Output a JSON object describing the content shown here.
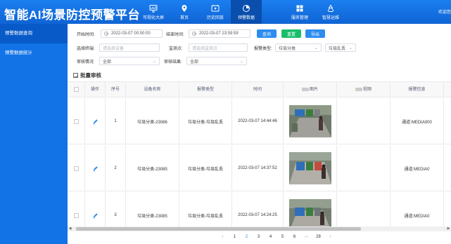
{
  "header": {
    "app_title": "智能AI场景防控预警平台",
    "welcome": "欢迎您",
    "nav": [
      {
        "label": "可视化大屏",
        "icon": "chart-monitor-icon"
      },
      {
        "label": "首页",
        "icon": "location-pin-icon"
      },
      {
        "label": "历史回放",
        "icon": "history-play-icon"
      },
      {
        "label": "预警数据",
        "icon": "pie-chart-icon",
        "active": true
      },
      {
        "label": "服务管理",
        "icon": "grid-icon"
      },
      {
        "label": "智慧运维",
        "icon": "recycle-icon"
      }
    ]
  },
  "sidebar": {
    "items": [
      {
        "label": "预警数据查询",
        "active": true
      },
      {
        "label": "预警数据统计"
      }
    ]
  },
  "filters": {
    "start_label": "开始时间:",
    "start_value": "2022-03-07 00:00:00",
    "end_label": "结束时间:",
    "end_value": "2022-03-07 23:59:59",
    "query_btn": "查询",
    "reset_btn": "重置",
    "export_btn": "导出",
    "terminal_label": "选择终端:",
    "terminal_placeholder": "请选择设备",
    "monitor_label": "监测点:",
    "monitor_placeholder": "请选择监测点",
    "alarm_type_label": "报警类型:",
    "alarm_type_value": "垃圾分类",
    "alarm_subtype_value": "垃圾乱丢",
    "review_label": "审核情况",
    "review_value": "全部",
    "result_label": "审核结果:",
    "result_value": "全部"
  },
  "batch_label": "批量审核",
  "table": {
    "columns": [
      "",
      "操作",
      "序号",
      "设备名称",
      "报警类型",
      "时间",
      "图片",
      "视频",
      "报警信息"
    ],
    "rows": [
      {
        "index": "1",
        "device": "垃圾分类-23086",
        "type": "垃圾分类-垃圾乱丢",
        "time": "2022-03-07 14:44:46",
        "info": "通道:MEDIA000"
      },
      {
        "index": "2",
        "device": "垃圾分类-23085",
        "type": "垃圾分类-垃圾乱丢",
        "time": "2022-03-07 14:37:52",
        "info": "通道:MEDIA0"
      },
      {
        "index": "3",
        "device": "垃圾分类-23085",
        "type": "垃圾分类-垃圾乱丢",
        "time": "2022-03-07 14:24:25",
        "info": "通道:MEDIA0"
      }
    ]
  },
  "pagination": {
    "prev": "‹",
    "pages": [
      "1",
      "2",
      "3",
      "4",
      "5",
      "6",
      "···",
      "28"
    ],
    "current": "2",
    "next": "›"
  },
  "colors": {
    "header": "#1b7ff0",
    "sidebar": "#1173e6",
    "primary": "#2d8cf0",
    "success": "#19be6b"
  }
}
